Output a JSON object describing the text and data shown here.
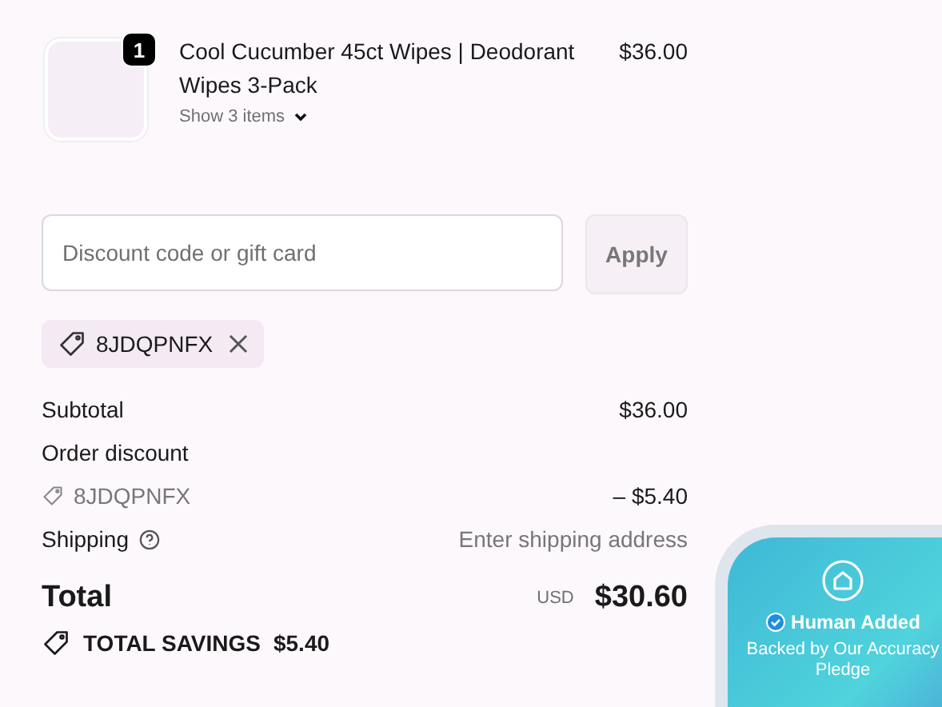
{
  "product": {
    "quantity": "1",
    "name": "Cool Cucumber 45ct Wipes | Deodorant Wipes 3-Pack",
    "price": "$36.00",
    "toggle": "Show 3 items"
  },
  "discount": {
    "placeholder": "Discount code or gift card",
    "button": "Apply",
    "applied_code": "8JDQPNFX"
  },
  "summary": {
    "subtotal_label": "Subtotal",
    "subtotal": "$36.00",
    "discount_label": "Order discount",
    "discount_code": "8JDQPNFX",
    "discount_amount": "– $5.40",
    "shipping_label": "Shipping",
    "shipping_value": "Enter shipping address",
    "total_label": "Total",
    "currency": "USD",
    "total": "$30.60",
    "savings_label": "TOTAL SAVINGS",
    "savings": "$5.40"
  },
  "badge": {
    "title": "Human Added",
    "subtitle": "Backed by Our Accuracy Pledge"
  }
}
